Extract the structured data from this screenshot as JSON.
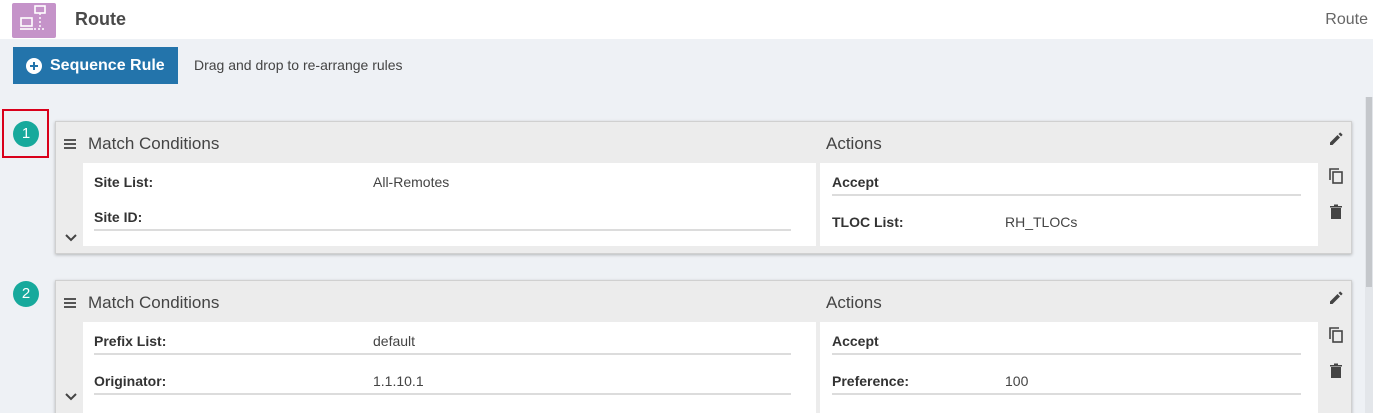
{
  "header": {
    "title": "Route",
    "right_label": "Route",
    "icon": "route-network-icon"
  },
  "toolbar": {
    "sequence_rule_label": "Sequence Rule",
    "hint": "Drag and drop to re-arrange rules"
  },
  "rules": [
    {
      "number": "1",
      "match_title": "Match Conditions",
      "actions_title": "Actions",
      "match": [
        {
          "label": "Site List:",
          "value": "All-Remotes"
        },
        {
          "label": "Site ID:",
          "value": ""
        }
      ],
      "actions": [
        {
          "label": "Accept",
          "value": ""
        },
        {
          "label": "TLOC List:",
          "value": "RH_TLOCs"
        }
      ]
    },
    {
      "number": "2",
      "match_title": "Match Conditions",
      "actions_title": "Actions",
      "match": [
        {
          "label": "Prefix List:",
          "value": "default"
        },
        {
          "label": "Originator:",
          "value": "1.1.10.1"
        }
      ],
      "actions": [
        {
          "label": "Accept",
          "value": ""
        },
        {
          "label": "Preference:",
          "value": "100"
        }
      ]
    }
  ],
  "colors": {
    "accent": "#2374ab",
    "badge": "#17a99c",
    "header_icon": "#c593c9",
    "highlight": "#d9001b"
  }
}
